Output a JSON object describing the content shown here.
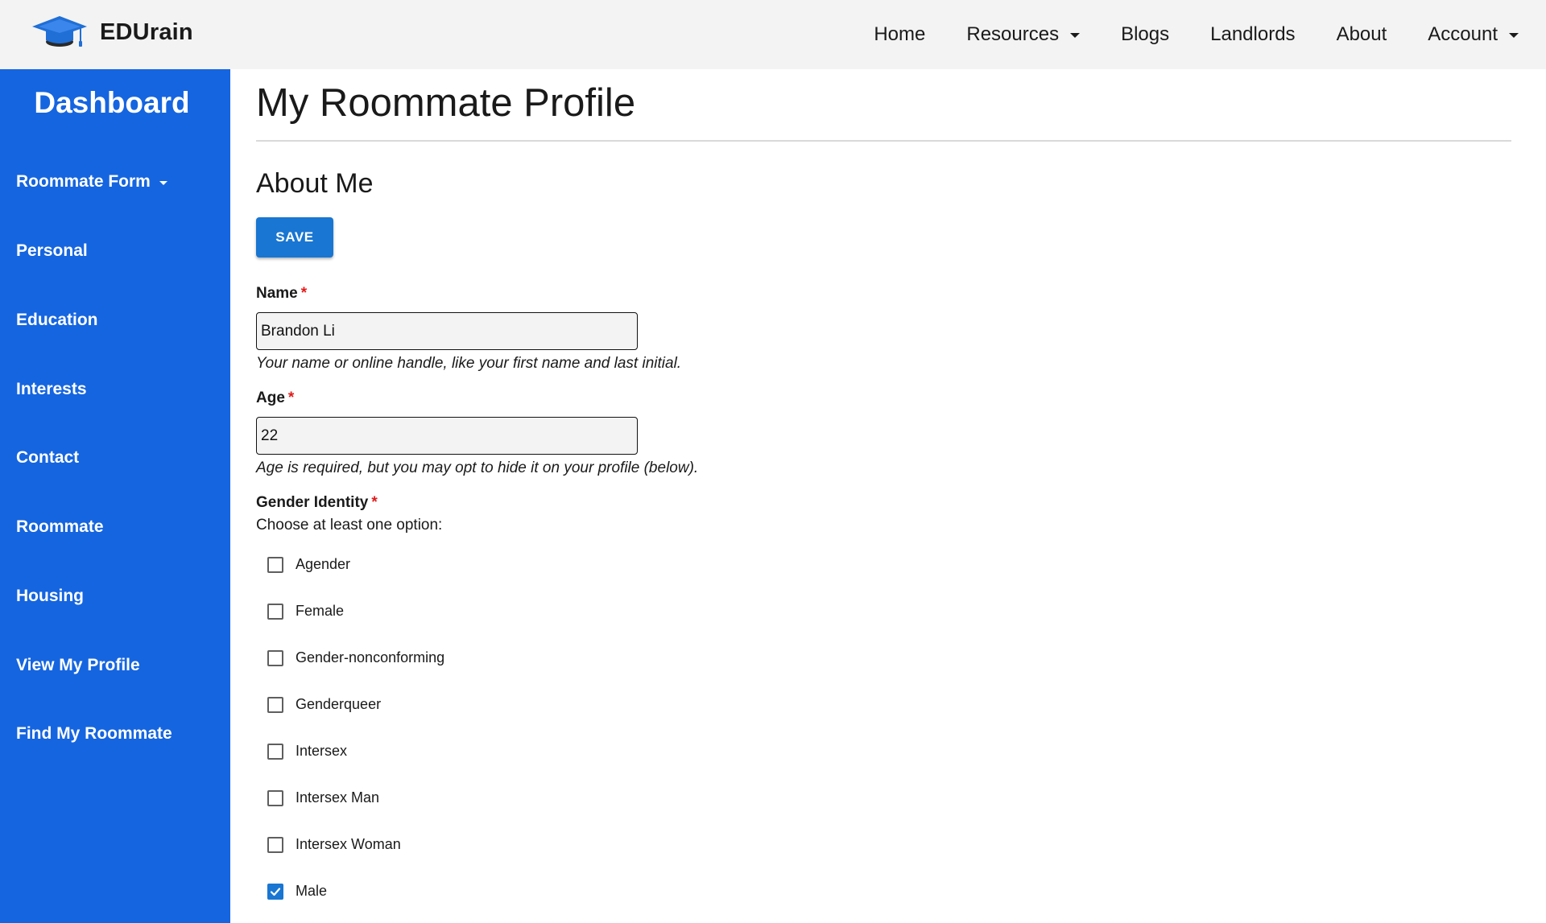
{
  "brand": {
    "name": "EDUrain",
    "logo_icon": "graduation-cap-icon",
    "logo_color": "#1f6fd6"
  },
  "nav": {
    "items": [
      {
        "label": "Home",
        "has_dropdown": false
      },
      {
        "label": "Resources",
        "has_dropdown": true
      },
      {
        "label": "Blogs",
        "has_dropdown": false
      },
      {
        "label": "Landlords",
        "has_dropdown": false
      },
      {
        "label": "About",
        "has_dropdown": false
      },
      {
        "label": "Account",
        "has_dropdown": true
      }
    ]
  },
  "sidebar": {
    "title": "Dashboard",
    "background": "#1565e0",
    "items": [
      {
        "label": "Roommate Form",
        "has_dropdown": true
      },
      {
        "label": "Personal"
      },
      {
        "label": "Education"
      },
      {
        "label": "Interests"
      },
      {
        "label": "Contact"
      },
      {
        "label": "Roommate"
      },
      {
        "label": "Housing"
      },
      {
        "label": "View My Profile"
      },
      {
        "label": "Find My Roommate"
      }
    ]
  },
  "main": {
    "page_title": "My Roommate Profile",
    "section_title": "About Me",
    "save_label": "SAVE",
    "required_marker": "*",
    "name_field": {
      "label": "Name",
      "value": "Brandon Li",
      "help": "Your name or online handle, like your first name and last initial."
    },
    "age_field": {
      "label": "Age",
      "value": "22",
      "help": "Age is required, but you may opt to hide it on your profile (below)."
    },
    "gender_field": {
      "label": "Gender Identity",
      "instruction": "Choose at least one option:",
      "options": [
        {
          "label": "Agender",
          "checked": false
        },
        {
          "label": "Female",
          "checked": false
        },
        {
          "label": "Gender-nonconforming",
          "checked": false
        },
        {
          "label": "Genderqueer",
          "checked": false
        },
        {
          "label": "Intersex",
          "checked": false
        },
        {
          "label": "Intersex Man",
          "checked": false
        },
        {
          "label": "Intersex Woman",
          "checked": false
        },
        {
          "label": "Male",
          "checked": true
        }
      ]
    }
  },
  "colors": {
    "accent": "#1976d2",
    "required": "#e01b1b"
  }
}
